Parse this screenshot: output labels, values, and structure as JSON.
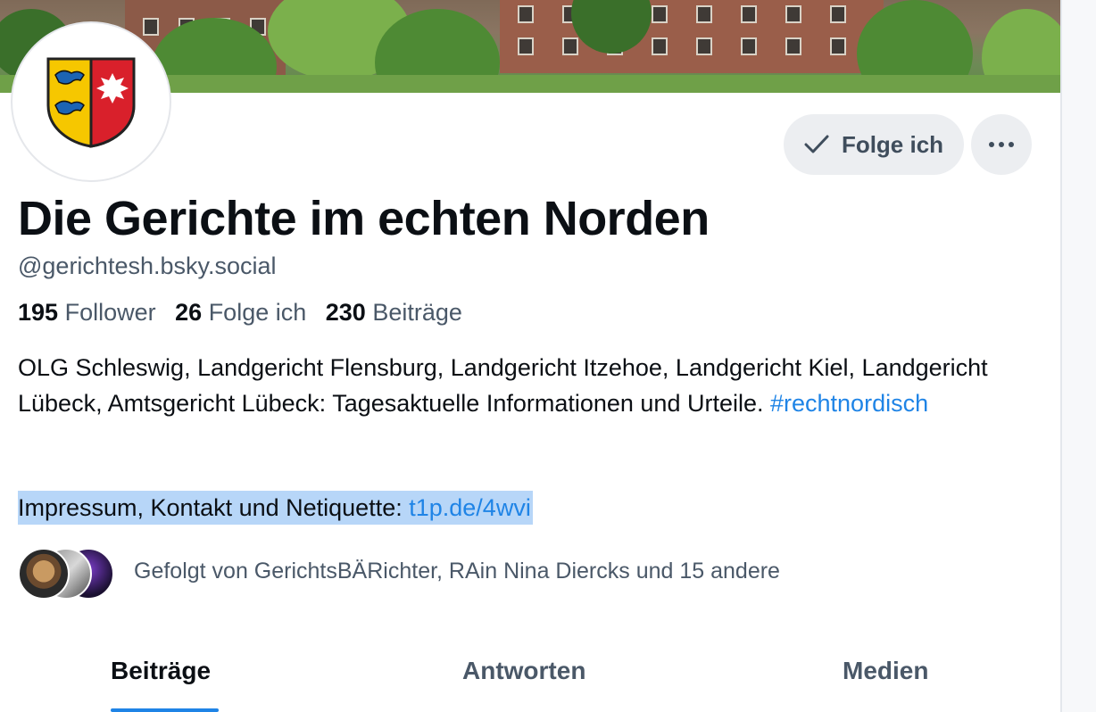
{
  "profile": {
    "display_name": "Die Gerichte im echten Norden",
    "handle": "@gerichtesh.bsky.social",
    "avatar_icon": "coat-of-arms-schleswig-holstein",
    "banner_icon": "court-building-photo"
  },
  "actions": {
    "follow_label": "Folge ich",
    "follow_icon": "checkmark-icon",
    "more_icon": "ellipsis-icon"
  },
  "stats": [
    {
      "value": "195",
      "label": "Follower"
    },
    {
      "value": "26",
      "label": "Folge ich"
    },
    {
      "value": "230",
      "label": "Beiträge"
    }
  ],
  "bio": {
    "text": "OLG Schleswig, Landgericht Flensburg, Landgericht Itzehoe, Landgericht Kiel, Landgericht Lübeck, Amtsgericht Lübeck: Tagesaktuelle Informationen und Urteile. ",
    "hashtag": "#rechtnordisch",
    "impressum_prefix": "Impressum, Kontakt und Netiquette: ",
    "impressum_link": "t1p.de/4wvi"
  },
  "followed_by": {
    "text": "Gefolgt von GerichtsBÄRichter, RAin Nina Diercks und 15 andere"
  },
  "tabs": [
    {
      "label": "Beiträge",
      "active": true
    },
    {
      "label": "Antworten",
      "active": false
    },
    {
      "label": "Medien",
      "active": false
    }
  ],
  "colors": {
    "accent": "#1f84e6",
    "selection": "#b7d6f8",
    "muted_text": "#4a5868"
  }
}
